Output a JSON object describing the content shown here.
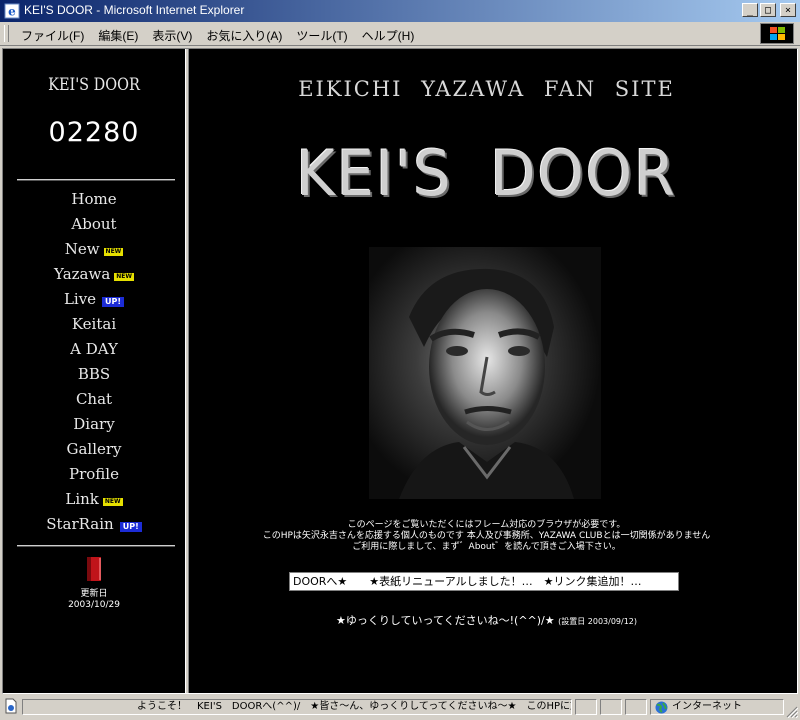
{
  "window": {
    "title": "KEI'S DOOR - Microsoft Internet Explorer",
    "controls": {
      "minimize": "_",
      "maximize": "□",
      "close": "×"
    }
  },
  "menu": [
    "ファイル(F)",
    "編集(E)",
    "表示(V)",
    "お気に入り(A)",
    "ツール(T)",
    "ヘルプ(H)"
  ],
  "sidebar": {
    "site_name": "KEI'S DOOR",
    "counter": "02280",
    "nav": [
      {
        "label": "Home",
        "badge": ""
      },
      {
        "label": "About",
        "badge": ""
      },
      {
        "label": "New",
        "badge": "NEW"
      },
      {
        "label": "Yazawa",
        "badge": "NEW"
      },
      {
        "label": "Live",
        "badge": "UP!"
      },
      {
        "label": "Keitai",
        "badge": ""
      },
      {
        "label": "A DAY",
        "badge": ""
      },
      {
        "label": "BBS",
        "badge": ""
      },
      {
        "label": "Chat",
        "badge": ""
      },
      {
        "label": "Diary",
        "badge": ""
      },
      {
        "label": "Gallery",
        "badge": ""
      },
      {
        "label": "Profile",
        "badge": ""
      },
      {
        "label": "Link",
        "badge": "NEW"
      },
      {
        "label": "StarRain",
        "badge": "UP!"
      }
    ],
    "update_label": "更新日",
    "update_date": "2003/10/29"
  },
  "main": {
    "tagline": "EIKICHI YAZAWA FAN SITE",
    "title": "KEI'S DOOR",
    "notice": [
      "このページをご覧いただくにはフレーム対応のブラウザが必要です。",
      "このHPは矢沢永吉さんを応援する個人のものです 本人及び事務所、YAZAWA CLUBとは一切関係がありません",
      "ご利用に際しまして、まず゛About゛を読んで頂きご入場下さい。"
    ],
    "marquee": "DOORへ★　　★表紙リニューアルしました！…　★リンク集追加！…",
    "welcome": "★ゆっくりしていってくださいね〜!(^^)/★",
    "established": "(設置日 2003/09/12)"
  },
  "statusbar": {
    "message": "ようこそ！　KEI'S　DOORへ(^^)/　★皆さ〜ん、ゆっくりしてってくださいね〜★　このHPに対する",
    "zone": "インターネット"
  },
  "colors": {
    "titlebar_start": "#0a246a",
    "titlebar_end": "#a6caf0",
    "page_background": "#000000",
    "new_badge": "#e6e000",
    "up_badge": "#1c2cd6"
  },
  "icons": [
    "ie-logo-icon",
    "windows-logo-icon",
    "update-book-icon",
    "page-icon",
    "globe-icon",
    "size-grip-icon"
  ]
}
